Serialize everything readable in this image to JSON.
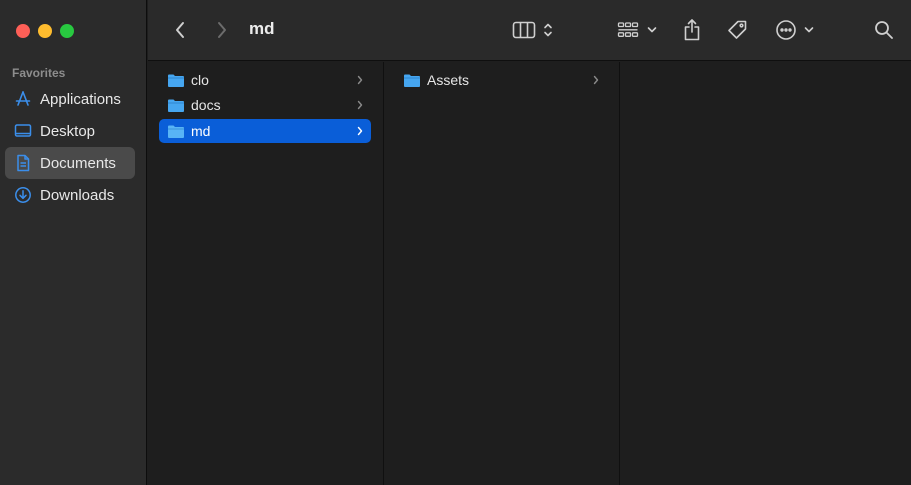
{
  "window": {
    "title": "md"
  },
  "sidebar": {
    "section_title": "Favorites",
    "items": [
      {
        "label": "Applications",
        "icon": "applications-icon",
        "selected": false
      },
      {
        "label": "Desktop",
        "icon": "desktop-icon",
        "selected": false
      },
      {
        "label": "Documents",
        "icon": "document-icon",
        "selected": true
      },
      {
        "label": "Downloads",
        "icon": "downloads-icon",
        "selected": false
      }
    ]
  },
  "toolbar": {
    "icons": [
      "back-icon",
      "forward-icon",
      "column-view-icon",
      "view-options-chevron-icon",
      "group-grid-icon",
      "group-chevron-icon",
      "share-icon",
      "tag-icon",
      "more-icon",
      "more-chevron-icon",
      "search-icon"
    ]
  },
  "columns": [
    {
      "items": [
        {
          "name": "clo",
          "selected": false
        },
        {
          "name": "docs",
          "selected": false
        },
        {
          "name": "md",
          "selected": true
        }
      ]
    },
    {
      "items": [
        {
          "name": "Assets",
          "selected": false
        }
      ]
    },
    {
      "items": []
    }
  ],
  "colors": {
    "accent": "#0a5ed8",
    "sidebar_icon": "#3b8eea",
    "folder": "#46a6f0"
  }
}
